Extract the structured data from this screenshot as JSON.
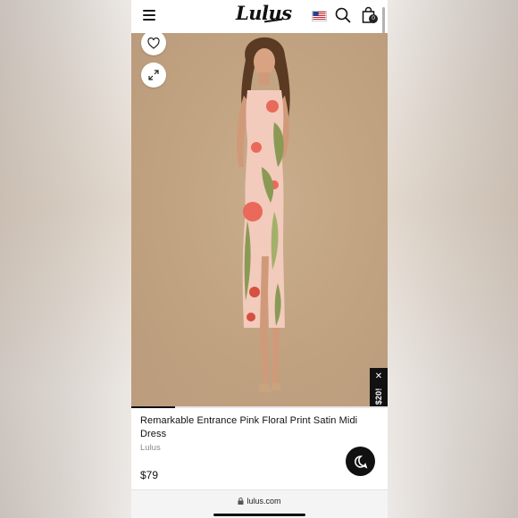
{
  "header": {
    "logo": "Lulus",
    "bag_count": "0",
    "icons": [
      "menu-icon",
      "us-flag-icon",
      "search-icon",
      "shopping-bag-icon"
    ]
  },
  "gallery": {
    "progress": 0.17,
    "promo_label": "Get $20!",
    "icons": [
      "heart-icon",
      "expand-icon",
      "close-icon"
    ]
  },
  "product": {
    "title": "Remarkable Entrance Pink Floral Print Satin Midi Dress",
    "brand": "Lulus",
    "price": "$79"
  },
  "browser": {
    "url": "lulus.com"
  },
  "colors": {
    "accent": "#111111",
    "backdrop": "#c2a482",
    "dress": "#f2cbbd",
    "flower": "#e96a5a",
    "leaf": "#8a9a55"
  }
}
